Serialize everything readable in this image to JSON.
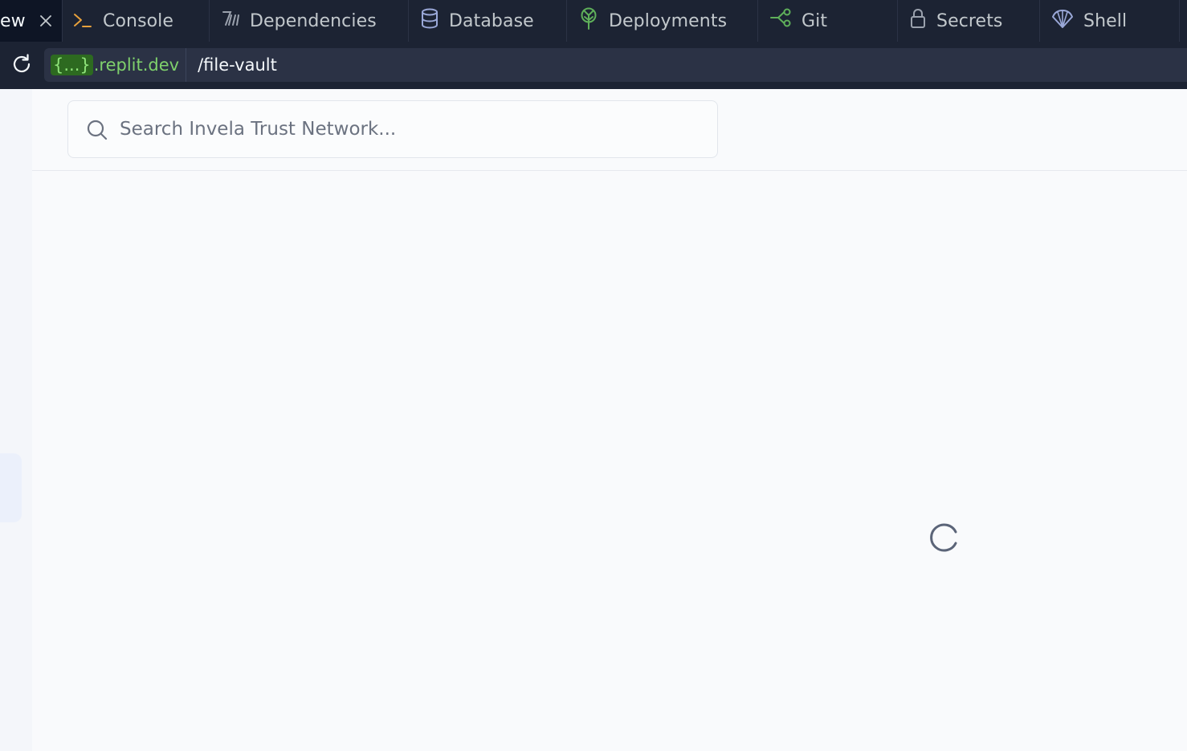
{
  "tabs": [
    {
      "label": "ew",
      "icon": "close-icon",
      "active": true
    },
    {
      "label": "Console",
      "icon": "terminal-icon"
    },
    {
      "label": "Dependencies",
      "icon": "dependencies-icon"
    },
    {
      "label": "Database",
      "icon": "database-icon"
    },
    {
      "label": "Deployments",
      "icon": "deployments-icon"
    },
    {
      "label": "Git",
      "icon": "git-icon"
    },
    {
      "label": "Secrets",
      "icon": "lock-icon"
    },
    {
      "label": "Shell",
      "icon": "shell-icon"
    }
  ],
  "address": {
    "domain_badge": "{...}",
    "domain": ".replit.dev",
    "path": "/file-vault"
  },
  "search": {
    "placeholder": "Search Invela Trust Network..."
  },
  "colors": {
    "chrome_bg": "#1c2333",
    "active_tab_bg": "#0e1525",
    "url_bg": "#2b3245",
    "domain_green": "#7fd16c",
    "page_bg": "#f9fafc",
    "accent_orange": "#e8a13c",
    "accent_green": "#5fb05a"
  }
}
